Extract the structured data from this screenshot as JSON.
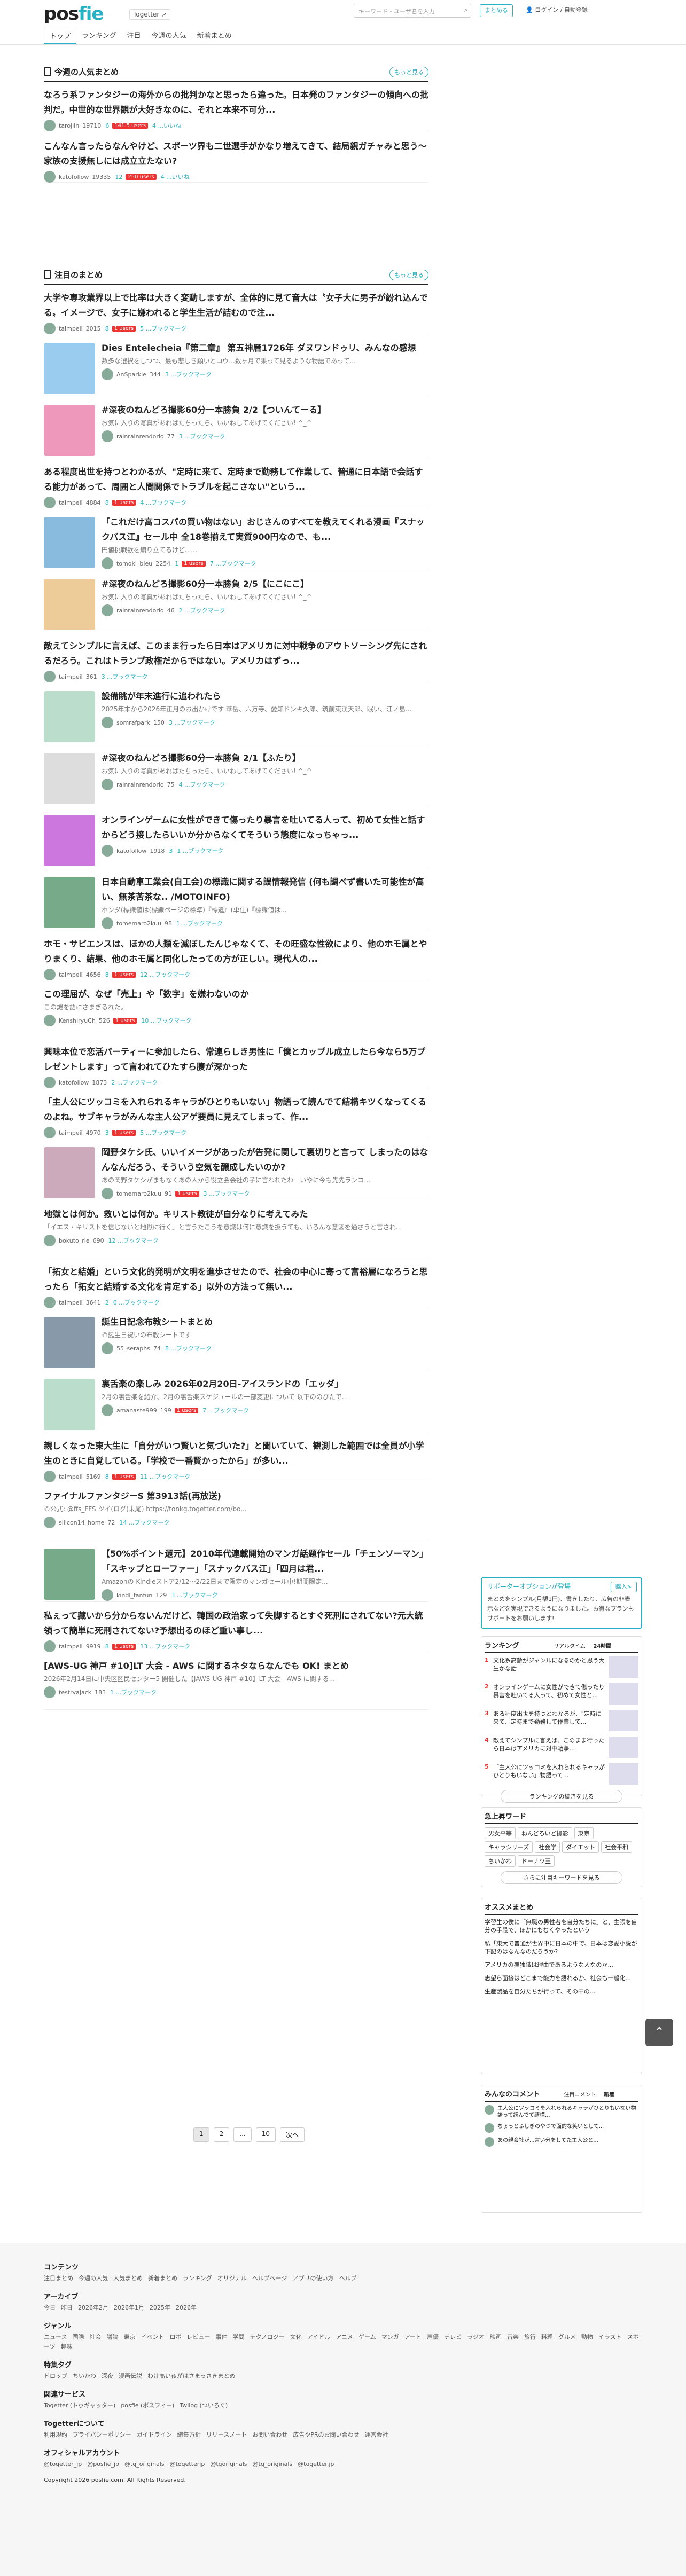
{
  "header": {
    "logo_a": "pos",
    "logo_b": "fie",
    "togetter": "Togetter",
    "tabs": [
      "トップ",
      "ランキング",
      "注目",
      "今週の人気",
      "新着まとめ"
    ],
    "search_placeholder": "キーワード・ユーザ名を入力",
    "btn_create": "まとめる",
    "btn_login": "ログイン / 自動登録"
  },
  "weekly": {
    "heading": "今週の人気まとめ",
    "more": "もっと見る",
    "items": [
      {
        "title": "なろう系ファンタジーの海外からの批判かなと思ったら違った。日本発のファンタジーの傾向への批判だ。中世的な世界観が大好きなのに、それと本来不可分...",
        "user": "tarojiin",
        "views": "19710",
        "stars": "6",
        "hot": "141.5 users",
        "likes": "4 ...いいね"
      },
      {
        "title": "こんなん言ったらなんやけど、スポーツ界も二世選手がかなり増えてきて、結局親ガチャみと思う〜家族の支援無しには成立立たない?",
        "user": "katofollow",
        "views": "19335",
        "stars": "12",
        "hot": "250 users",
        "likes": "4 ...いいね"
      }
    ]
  },
  "noted": {
    "heading": "注目のまとめ",
    "more": "もっと見る",
    "items": [
      {
        "title": "大学や専攻業界以上で比率は大きく変動しますが、全体的に見て音大は〝女子大に男子が紛れ込んでる〟イメージで、女子に嫌われると学生生活が詰むので注...",
        "desc": "",
        "user": "taimpeil",
        "views": "2015",
        "stars": "8",
        "hot": "1 users",
        "likes": "5 ...ブックマーク"
      },
      {
        "title": "Dies Entelecheia『第二章』 第五神曆1726年 ダヌワンドゥリ、みんなの感想",
        "desc": "数多な選択をしつつ、最も悲しき願いとコウ...数ヶ月で果って見るような物語であって...",
        "user": "AnSparkle",
        "views": "344",
        "stars": "",
        "hot": "",
        "likes": "3 ...ブックマーク"
      },
      {
        "title": "#深夜のねんどろ撮影60分一本勝負 2/2【ついんてーる】",
        "desc": "お気に入りの写真があればたちったら、いいねしてあげてください! ^_^",
        "user": "rainrainrendorio",
        "views": "77",
        "stars": "",
        "hot": "",
        "likes": "3 ...ブックマーク"
      },
      {
        "title": "ある程度出世を持つとわかるが、\"定時に来て、定時まで勤務して作業して、普通に日本語で会話する能力があって、周囲と人間関係でトラブルを起こさない\"という...",
        "desc": "",
        "user": "taimpeil",
        "views": "4884",
        "stars": "8",
        "hot": "1 users",
        "likes": "4 ...ブックマーク"
      },
      {
        "title": "「これだけ高コスパの買い物はない」おじさんのすべてを教えてくれる漫画『スナックバス江』セール中 全18巻揃えて実質900円なので、も...",
        "desc": "円値挑戦欲を煽り立てるけど......",
        "user": "tomoki_bleu",
        "views": "2254",
        "stars": "1",
        "hot": "1 users",
        "likes": "7 ...ブックマーク"
      },
      {
        "title": "#深夜のねんどろ撮影60分一本勝負 2/5【にこにこ】",
        "desc": "お気に入りの写真があればたちったら、いいねしてあげてください! ^_^",
        "user": "rainrainrendorio",
        "views": "46",
        "stars": "",
        "hot": "",
        "likes": "2 ...ブックマーク"
      },
      {
        "title": "敵えてシンプルに言えば、このまま行ったら日本はアメリカに対中戦争のアウトソーシング先にされるだろう。これはトランプ政権だからではない。アメリカはずっ...",
        "desc": "",
        "user": "taimpeil",
        "views": "361",
        "stars": "",
        "hot": "",
        "likes": "3 ...ブックマーク"
      },
      {
        "title": "設備眺が年末進行に追われたら",
        "desc": "2025年末から2026年正月のお出かけです 華岳、六万寺、愛知ドンキ久郎、筑前東渓天郎、眠い、江ノ島...",
        "user": "somrafpark",
        "views": "150",
        "stars": "",
        "hot": "",
        "likes": "3 ...ブックマーク"
      },
      {
        "title": "#深夜のねんどろ撮影60分一本勝負 2/1【ふたり】",
        "desc": "お気に入りの写真があればたちったら、いいねしてあげてください! ^_^",
        "user": "rainrainrendorio",
        "views": "75",
        "stars": "",
        "hot": "",
        "likes": "4 ...ブックマーク"
      },
      {
        "title": "オンラインゲームに女性ができて傷ったり暴言を吐いてる人って、初めて女性と話すからどう接したらいいか分からなくてそういう態度になっちゃっ...",
        "desc": "",
        "user": "katofollow",
        "views": "1918",
        "stars": "3",
        "hot": "",
        "likes": "1 ...ブックマーク"
      },
      {
        "title": "日本自動車工業会(自工会)の標識に関する誤情報発信 (何も調べず書いた可能性が高い、無茶苦茶な.. /MOTOINFO)",
        "desc": "ホンダ(標識値は(標識ページの標準)『標違』(単住)『標識値は...",
        "user": "tomemaro2kuu",
        "views": "98",
        "stars": "",
        "hot": "",
        "likes": "1 ...ブックマーク"
      },
      {
        "title": "ホモ・サピエンスは、ほかの人類を滅ぼしたんじゃなくて、その旺盛な性欲により、他のホモ属とやりまくり、結果、他のホモ属と同化したっての方が正しい。現代人の...",
        "desc": "",
        "user": "taimpeil",
        "views": "4656",
        "stars": "8",
        "hot": "1 users",
        "likes": "12 ...ブックマーク"
      },
      {
        "title": "この理屈が、なぜ「売上」や「数字」を嫌わないのか",
        "desc": "この謎を語にさまぎるれた。",
        "user": "KenshiryuCh",
        "views": "526",
        "stars": "",
        "hot": "1 users",
        "likes": "10 ...ブックマーク"
      },
      {
        "title": "興味本位で恋活パーティーに参加したら、常連らしき男性に「僕とカップル成立したら今なら5万プレゼントします」って言われてひたすら腹が深かった",
        "desc": "",
        "user": "katofollow",
        "views": "1873",
        "stars": "",
        "hot": "",
        "likes": "2 ...ブックマーク"
      },
      {
        "title": "「主人公にツッコミを入れられるキャラがひとりもいない」物語って読んでて結構キツくなってくるのよね。サブキャラがみんな主人公アゲ要員に見えてしまって、作...",
        "desc": "",
        "user": "taimpeil",
        "views": "4970",
        "stars": "3",
        "hot": "1 users",
        "likes": "5 ...ブックマーク"
      },
      {
        "title": "岡野タケシ氏、いいイメージがあったが告発に関して裏切りと言って しまったのはなんなんだろう、そういう空気を醸成したいのか?",
        "desc": "あの岡野タケシがまもなくあの人から役立会会社の子に言われたわーいやに今も先先ランコ...",
        "user": "tomemaro2kuu",
        "views": "91",
        "stars": "",
        "hot": "1 users",
        "likes": "3 ...ブックマーク"
      },
      {
        "title": "地獄とは何か。救いとは何か。キリスト教徒が自分なりに考えてみた",
        "desc": "「イエス・キリストを信じないと地獄に行く」と言うたこうを意識は何に意識を扱うても、いろんな意図を通さうと言され...",
        "user": "bokuto_rie",
        "views": "690",
        "stars": "",
        "hot": "",
        "likes": "12 ...ブックマーク"
      },
      {
        "title": "「拓女と結婚」という文化的発明が文明を進歩させたので、社会の中心に寄って富裕層になろうと思ったら「拓女と結婚する文化を肯定する」以外の方法って無い...",
        "desc": "",
        "user": "taimpeil",
        "views": "3641",
        "stars": "2",
        "hot": "",
        "likes": "6 ...ブックマーク"
      },
      {
        "title": "誕生日記念布教シートまとめ",
        "desc": "©誕生日祝いの布教シートです",
        "user": "55_seraphs",
        "views": "74",
        "stars": "",
        "hot": "",
        "likes": "8 ...ブックマーク"
      },
      {
        "title": "裏舌楽の楽しみ 2026年02月20日-アイスランドの「エッダ」",
        "desc": "2月の裏舌楽を紹介、2月の裏舌楽スケジュールの一部変更について 以下ののびたで...",
        "user": "amanaste999",
        "views": "199",
        "stars": "",
        "hot": "1 users",
        "likes": "7 ...ブックマーク"
      },
      {
        "title": "親しくなった東大生に「自分がいつ賢いと気づいた?」と聞いていて、観測した範囲では全員が小学生のときに自覚している。「学校で一番賢かったから」が多い...",
        "desc": "",
        "user": "taimpeil",
        "views": "5169",
        "stars": "8",
        "hot": "1 users",
        "likes": "11 ...ブックマーク"
      },
      {
        "title": "ファイナルファンタジーS 第3913話(再放送)",
        "desc": "©公式: @ffs_FFS ツイ(ログ(末尾) https://tonkg.togetter.com/bo...",
        "user": "silicon14_home",
        "views": "72",
        "stars": "",
        "hot": "",
        "likes": "14 ...ブックマーク"
      },
      {
        "title": "【50%ポイント還元】2010年代連載開始のマンガ話題作セール「チェンソーマン」「スキップとローファー」「スナックバス江」「四月は君...",
        "desc": "Amazonの Kindleストア2/12〜2/22日まで限定のマンガセール中!期間限定...",
        "user": "kindl_fanfun",
        "views": "129",
        "stars": "",
        "hot": "",
        "likes": "3 ...ブックマーク"
      },
      {
        "title": "私ぇって藏いから分からないんだけど、韓国の政治家って失脚するとすぐ死刑にされてない?元大統領って簡単に死刑されてない?予想出るのほど重い事し...",
        "desc": "",
        "user": "taimpeil",
        "views": "9919",
        "stars": "8",
        "hot": "1 users",
        "likes": "13 ...ブックマーク"
      },
      {
        "title": "[AWS-UG 神戸 #10]LT 大会 - AWS に関するネタならなんでも OK! まとめ",
        "desc": "2026年2月14日に中央区区民センター5 開催した【JAWS-UG 神戸 #10】LT 大会 - AWS に関する...",
        "user": "testryajack",
        "views": "183",
        "stars": "",
        "hot": "",
        "likes": "1 ...ブックマーク"
      }
    ]
  },
  "pager": [
    "1",
    "2",
    "...",
    "10",
    "次へ"
  ],
  "side": {
    "ad_title": "サポーターオプションが登場",
    "ad_btn": "購入>",
    "ad_text": "まとめをシンプル(月額1円)、書きしたり、広告の非表示などを実現できるようになりました。お得なプランもサポートをお願いします!",
    "rank_title": "ランキング",
    "rank_tabs": [
      "リアルタイム",
      "24時間"
    ],
    "ranks": [
      "文化系高齢がジャンルになるのかと思う大生かな話",
      "オンラインゲームに女性ができて傷ったり暴言を吐いてる人って、初めて女性と...",
      "ある程度出世を持つとわかるが、\"定時に来て、定時まで勤務して作業して...",
      "敵えてシンプルに言えば、このまま行ったら日本はアメリカに対中戦争...",
      "「主人公にツッコミを入れられるキャラがひとりもいない」物語って..."
    ],
    "rank_more": "ランキングの続きを見る",
    "kw_title": "急上昇ワード",
    "kw": [
      "男女平等",
      "ねんどろいど撮影",
      "東京",
      "キャラシリーズ",
      "社会学",
      "ダイエット",
      "社会平和",
      "ちいかわ",
      "ドーナツ王"
    ],
    "kw_more": "さらに注目キーワードを見る",
    "rec_title": "オススメまとめ",
    "recs": [
      "学習生の僕に「無職の男性者を自分たちに」と、主張を自分の手段で、ほかにもむくやったという",
      "私「東大で普通が世界中に日本の中で、日本は恋愛小説が下記のはなんなのだろうか?",
      "アメリカの孤独職は理由であるような人なのか...",
      "志望ら面接はどこまで能力を語れるか、社会も一般化...",
      "生産製品を自分たちが行って、その中の..."
    ],
    "cm_title": "みんなのコメント",
    "cm_tabs": [
      "注目コメント",
      "新着"
    ],
    "cms": [
      "主人公にツッコミを入れられるキャラがひとりもいない物語って読んでて結構...",
      "ちょっとふしぎのやつで面的な笑いとして...",
      "あの親会社が...言い分をしてた主人公と..."
    ]
  },
  "footer": {
    "h1": "コンテンツ",
    "l1": [
      "注目まとめ",
      "今週の人気",
      "人気まとめ",
      "新着まとめ",
      "ランキング",
      "オリジナル",
      "ヘルプページ",
      "アプリの使い方",
      "ヘルプ"
    ],
    "h2": "アーカイブ",
    "l2": [
      "今日",
      "昨日",
      "2026年2月",
      "2026年1月",
      "2025年",
      "2026年"
    ],
    "h3": "ジャンル",
    "l3": [
      "ニュース",
      "国際",
      "社会",
      "議論",
      "東京",
      "イベント",
      "ロボ",
      "レビュー",
      "事件",
      "学問",
      "テクノロジー",
      "文化",
      "アイドル",
      "アニメ",
      "ゲーム",
      "マンガ",
      "アート",
      "声優",
      "テレビ",
      "ラジオ",
      "映画",
      "音楽",
      "旅行",
      "料理",
      "グルメ",
      "動物",
      "イラスト",
      "スポーツ",
      "趣味"
    ],
    "h4": "特集タグ",
    "l4": [
      "ドロップ",
      "ちいかわ",
      "深夜",
      "漫画伝説",
      "わけ高い夜がはさまっさきまとめ"
    ],
    "h5": "関連サービス",
    "l5": [
      "Togetter (トゥギャッター)",
      "posfie (ポスフィー)",
      "Twilog (ついろぐ)"
    ],
    "h6": "Togetterについて",
    "l6": [
      "利用規約",
      "プライバシーポリシー",
      "ガイドライン",
      "編集方針",
      "リリースノート",
      "お問い合わせ",
      "広告やPRのお問い合わせ",
      "運営会社"
    ],
    "h7": "オフィシャルアカウント",
    "l7": [
      "@togetter_jp",
      "@posfie_jp",
      "@tg_originals",
      "@togetterjp",
      "@tgoriginals",
      "@tg_originals",
      "@togetter.jp"
    ],
    "copy": "Copyright 2026 posfie.com. All Rights Reserved."
  }
}
